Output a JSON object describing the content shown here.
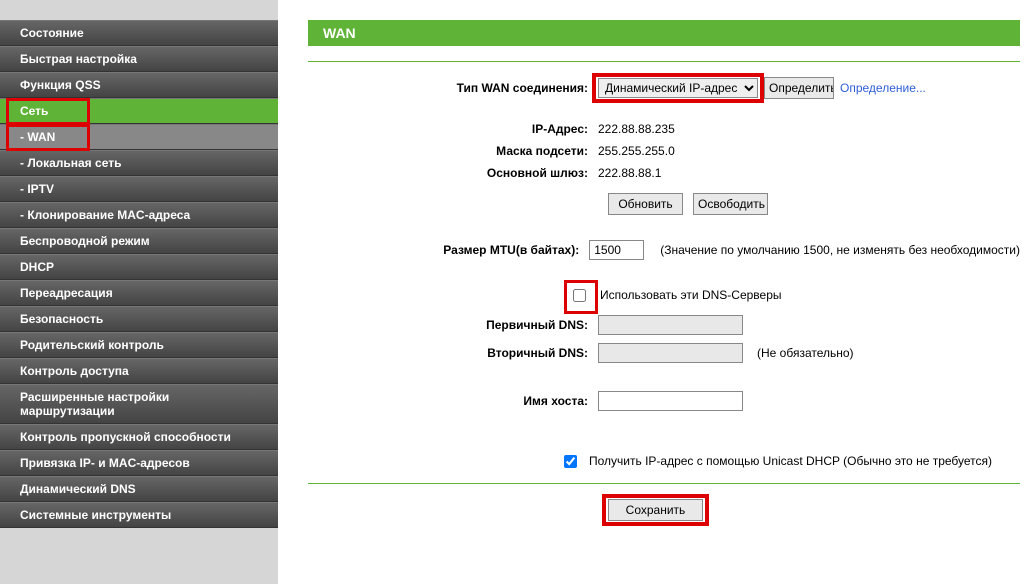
{
  "sidebar": {
    "items": [
      {
        "label": "Состояние"
      },
      {
        "label": "Быстрая настройка"
      },
      {
        "label": "Функция QSS"
      },
      {
        "label": "Сеть"
      },
      {
        "label": "- WAN"
      },
      {
        "label": "- Локальная сеть"
      },
      {
        "label": "- IPTV"
      },
      {
        "label": "- Клонирование MAC-адреса"
      },
      {
        "label": "Беспроводной режим"
      },
      {
        "label": "DHCP"
      },
      {
        "label": "Переадресация"
      },
      {
        "label": "Безопасность"
      },
      {
        "label": "Родительский контроль"
      },
      {
        "label": "Контроль доступа"
      },
      {
        "label": "Расширенные настройки маршрутизации"
      },
      {
        "label": "Контроль пропускной способности"
      },
      {
        "label": "Привязка IP- и MAC-адресов"
      },
      {
        "label": "Динамический DNS"
      },
      {
        "label": "Системные инструменты"
      }
    ]
  },
  "page": {
    "title": "WAN",
    "labels": {
      "conn_type": "Тип WAN соединения:",
      "ip": "IP-Адрес:",
      "mask": "Маска подсети:",
      "gateway": "Основной шлюз:",
      "mtu": "Размер MTU(в байтах):",
      "use_dns": "Использовать эти DNS-Серверы",
      "dns1": "Первичный DNS:",
      "dns2": "Вторичный DNS:",
      "host": "Имя хоста:",
      "unicast": "Получить IP-адрес с помощью Unicast DHCP (Обычно это не требуется)"
    },
    "values": {
      "conn_type": "Динамический IP-адрес",
      "ip": "222.88.88.235",
      "mask": "255.255.255.0",
      "gateway": "222.88.88.1",
      "mtu": "1500",
      "dns1": "",
      "dns2": "",
      "host": ""
    },
    "hints": {
      "mtu": "(Значение по умолчанию 1500, не изменять без необходимости)",
      "dns2": "(Не обязательно)"
    },
    "buttons": {
      "detect": "Определить",
      "detecting": "Определение...",
      "update": "Обновить",
      "release": "Освободить",
      "save": "Сохранить"
    }
  }
}
